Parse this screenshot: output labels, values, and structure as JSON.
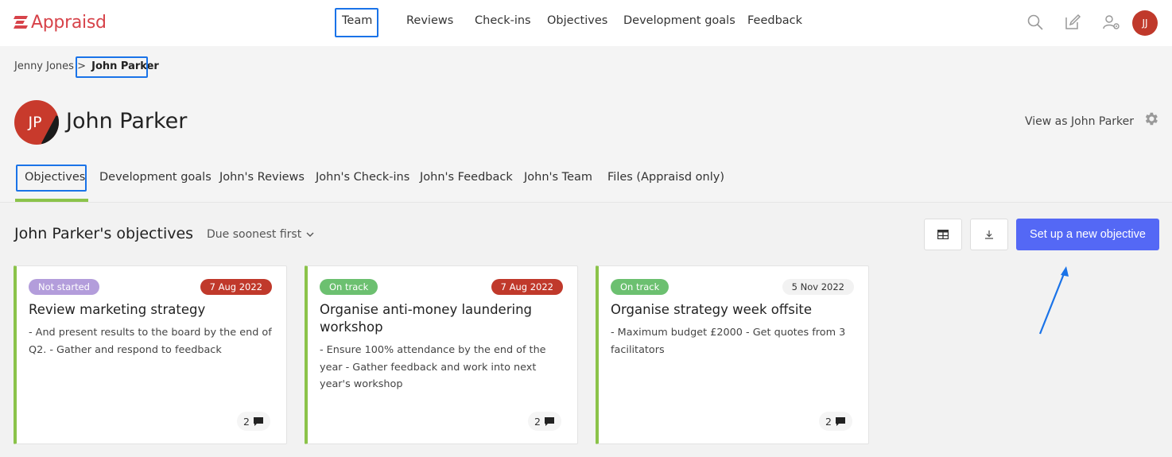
{
  "app": {
    "brand": "Appraisd",
    "brand_color": "#d7434a"
  },
  "topnav": {
    "items": [
      "Team",
      "Reviews",
      "Check-ins",
      "Objectives",
      "Development goals",
      "Feedback"
    ],
    "icons": [
      "search-icon",
      "edit-icon",
      "user-settings-icon"
    ],
    "user_initials": "JJ"
  },
  "breadcrumb": {
    "parent": "Jenny Jones",
    "separator": ">",
    "current": "John Parker"
  },
  "profile": {
    "initials": "JP",
    "name": "John Parker",
    "view_as": "View as John Parker"
  },
  "subtabs": [
    "Objectives",
    "Development goals",
    "John's Reviews",
    "John's Check-ins",
    "John's Feedback",
    "John's Team",
    "Files (Appraisd only)"
  ],
  "objectives": {
    "title": "John Parker's objectives",
    "sort_label": "Due soonest first",
    "new_button": "Set up a new objective",
    "accent_color": "#5468f5",
    "cards": [
      {
        "status": "Not started",
        "status_color": "#b39ddb",
        "date": "7 Aug 2022",
        "date_style": "overdue",
        "title": "Review marketing strategy",
        "description": "- And present results to the board by the end of Q2. - Gather and respond to feedback",
        "comments": "2"
      },
      {
        "status": "On track",
        "status_color": "#6cc070",
        "date": "7 Aug 2022",
        "date_style": "overdue",
        "title": "Organise anti-money laundering workshop",
        "description": "- Ensure 100% attendance by the end of the year - Gather feedback and work into next year's workshop",
        "comments": "2"
      },
      {
        "status": "On track",
        "status_color": "#6cc070",
        "date": "5 Nov 2022",
        "date_style": "normal",
        "title": "Organise strategy week offsite",
        "description": "- Maximum budget £2000 - Get quotes from 3 facilitators",
        "comments": "2"
      }
    ]
  }
}
